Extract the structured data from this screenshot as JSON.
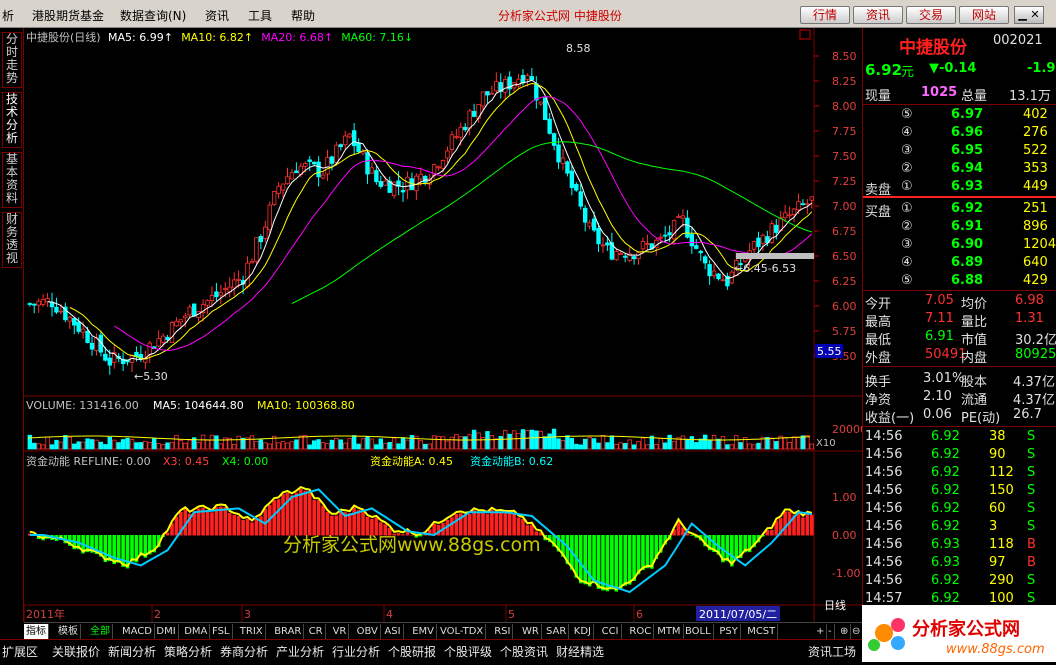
{
  "menu": [
    "析",
    "港股期货基金",
    "数据查询(N)",
    "资讯",
    "工具",
    "帮助"
  ],
  "app_title": "分析家公式网  中捷股份",
  "top_buttons": [
    "行情",
    "资讯",
    "交易",
    "网站"
  ],
  "side_tabs": [
    "分时走势",
    "技术分析",
    "基本资料",
    "财务透视"
  ],
  "price_panel": {
    "header": "中捷股份(日线)",
    "mas": [
      {
        "label": "MA5: 6.99",
        "color": "#ffffff"
      },
      {
        "label": "MA10: 6.82",
        "color": "#ffff00"
      },
      {
        "label": "MA20: 6.68",
        "color": "#ff00ff"
      },
      {
        "label": "MA60: 7.16",
        "color": "#00ff00"
      }
    ],
    "y_ticks": [
      "8.50",
      "8.25",
      "8.00",
      "7.75",
      "7.50",
      "7.25",
      "7.00",
      "6.75",
      "6.50",
      "6.25",
      "6.00",
      "5.75",
      "5.50"
    ],
    "high_label": "8.58",
    "low_label": "5.30",
    "range_label": "6.45-6.53",
    "cursor_price": "5.55"
  },
  "volume_panel": {
    "label": "VOLUME: 131416.00",
    "ma5": "MA5: 104644.80",
    "ma10": "MA10: 100368.80",
    "y_tick": "20000",
    "unit": "X10"
  },
  "fund_panel": {
    "label": "资金动能 REFLINE: 0.00",
    "x3": "X3: 0.45",
    "x4": "X4: 0.00",
    "a": "资金动能A: 0.45",
    "b": "资金动能B: 0.62",
    "y_ticks": [
      "1.00",
      "0.00",
      "-1.00"
    ]
  },
  "watermark": "分析家公式网www.88gs.com",
  "x_axis": {
    "labels": [
      "2011年",
      "2",
      "3",
      "4",
      "5",
      "6"
    ],
    "cursor_date": "2011/07/05/二",
    "period": "日线"
  },
  "bottom_tabs": [
    "指标",
    "模板",
    "全部",
    "MACD",
    "DMI",
    "DMA",
    "FSL",
    "TRIX",
    "BRAR",
    "CR",
    "VR",
    "OBV",
    "ASI",
    "EMV",
    "VOL-TDX",
    "RSI",
    "WR",
    "SAR",
    "KDJ",
    "CCI",
    "ROC",
    "MTM",
    "BOLL",
    "PSY",
    "MCST"
  ],
  "bottom_tabs2": [
    "扩展区",
    "关联报价",
    "新闻分析",
    "策略分析",
    "券商分析",
    "产业分析",
    "行业分析",
    "个股研报",
    "个股评级",
    "个股资讯",
    "财经精选",
    "资讯工场"
  ],
  "quote": {
    "name": "中捷股份",
    "code": "002021",
    "price": "6.92",
    "unit": "元",
    "change": "▼-0.14",
    "pct": "-1.9",
    "now_label": "现量",
    "now_val": "1025",
    "total_label": "总量",
    "total_val": "13.1万",
    "asks": [
      {
        "lv": "⑤",
        "p": "6.97",
        "v": "402"
      },
      {
        "lv": "④",
        "p": "6.96",
        "v": "276"
      },
      {
        "lv": "③",
        "p": "6.95",
        "v": "522"
      },
      {
        "lv": "②",
        "p": "6.94",
        "v": "353"
      },
      {
        "lv": "①",
        "p": "6.93",
        "v": "449",
        "label": "卖盘"
      }
    ],
    "bids": [
      {
        "lv": "①",
        "p": "6.92",
        "v": "251",
        "label": "买盘"
      },
      {
        "lv": "②",
        "p": "6.91",
        "v": "896"
      },
      {
        "lv": "③",
        "p": "6.90",
        "v": "1204"
      },
      {
        "lv": "④",
        "p": "6.89",
        "v": "640"
      },
      {
        "lv": "⑤",
        "p": "6.88",
        "v": "429"
      }
    ],
    "stats": [
      {
        "l1": "今开",
        "v1": "7.05",
        "l2": "均价",
        "v2": "6.98"
      },
      {
        "l1": "最高",
        "v1": "7.11",
        "l2": "量比",
        "v2": "1.31"
      },
      {
        "l1": "最低",
        "v1": "6.91",
        "l2": "市值",
        "v2": "30.2亿"
      },
      {
        "l1": "外盘",
        "v1": "50491",
        "l2": "内盘",
        "v2": "80925"
      }
    ],
    "stats2": [
      {
        "l1": "换手",
        "v1": "3.01%",
        "l2": "股本",
        "v2": "4.37亿"
      },
      {
        "l1": "净资",
        "v1": "2.10",
        "l2": "流通",
        "v2": "4.37亿"
      },
      {
        "l1": "收益(一)",
        "v1": "0.06",
        "l2": "PE(动)",
        "v2": "26.7"
      }
    ],
    "ticks": [
      {
        "t": "14:56",
        "p": "6.92",
        "v": "38",
        "d": "S"
      },
      {
        "t": "14:56",
        "p": "6.92",
        "v": "90",
        "d": "S"
      },
      {
        "t": "14:56",
        "p": "6.92",
        "v": "112",
        "d": "S"
      },
      {
        "t": "14:56",
        "p": "6.92",
        "v": "150",
        "d": "S"
      },
      {
        "t": "14:56",
        "p": "6.92",
        "v": "60",
        "d": "S"
      },
      {
        "t": "14:56",
        "p": "6.92",
        "v": "3",
        "d": "S"
      },
      {
        "t": "14:56",
        "p": "6.93",
        "v": "118",
        "d": "B"
      },
      {
        "t": "14:56",
        "p": "6.93",
        "v": "97",
        "d": "B"
      },
      {
        "t": "14:56",
        "p": "6.92",
        "v": "290",
        "d": "S"
      },
      {
        "t": "14:57",
        "p": "6.92",
        "v": "100",
        "d": "S"
      }
    ]
  },
  "logo": {
    "text": "分析家公式网",
    "url": "www.88gs.com"
  }
}
